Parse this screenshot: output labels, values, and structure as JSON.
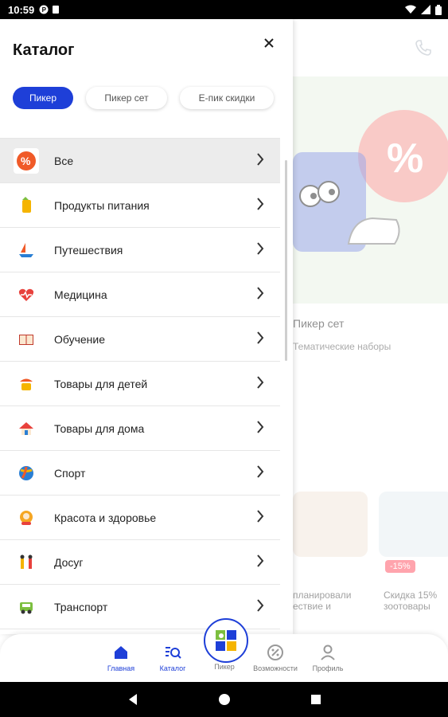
{
  "status": {
    "time": "10:59"
  },
  "drawer": {
    "title": "Каталог"
  },
  "chips": [
    {
      "label": "Пикер"
    },
    {
      "label": "Пикер сет"
    },
    {
      "label": "E-пик скидки"
    }
  ],
  "categories": [
    {
      "label": "Все",
      "icon": "percent-icon"
    },
    {
      "label": "Продукты питания",
      "icon": "food-icon"
    },
    {
      "label": "Путешествия",
      "icon": "boat-icon"
    },
    {
      "label": "Медицина",
      "icon": "heart-pulse-icon"
    },
    {
      "label": "Обучение",
      "icon": "book-icon"
    },
    {
      "label": "Товары для детей",
      "icon": "kids-icon"
    },
    {
      "label": "Товары для дома",
      "icon": "house-icon"
    },
    {
      "label": "Спорт",
      "icon": "ball-icon"
    },
    {
      "label": "Красота и здоровье",
      "icon": "beauty-icon"
    },
    {
      "label": "Досуг",
      "icon": "leisure-icon"
    },
    {
      "label": "Транспорт",
      "icon": "car-icon"
    }
  ],
  "background": {
    "card_title": "Пикер сет",
    "card_subtitle": "Тематические наборы",
    "promo_badge": "-15%",
    "promo_text_1": "планировали ествие и",
    "promo_text_2": "Скидка 15% зоотовары"
  },
  "bottom_nav": [
    {
      "label": "Главная",
      "icon": "home-icon"
    },
    {
      "label": "Каталог",
      "icon": "catalog-search-icon"
    },
    {
      "label": "Пикер",
      "icon": "picker-icon"
    },
    {
      "label": "Возможности",
      "icon": "percent-badge-icon"
    },
    {
      "label": "Профиль",
      "icon": "profile-icon"
    }
  ],
  "colors": {
    "accent": "#1e3fd8",
    "selected_row": "#ececec"
  }
}
